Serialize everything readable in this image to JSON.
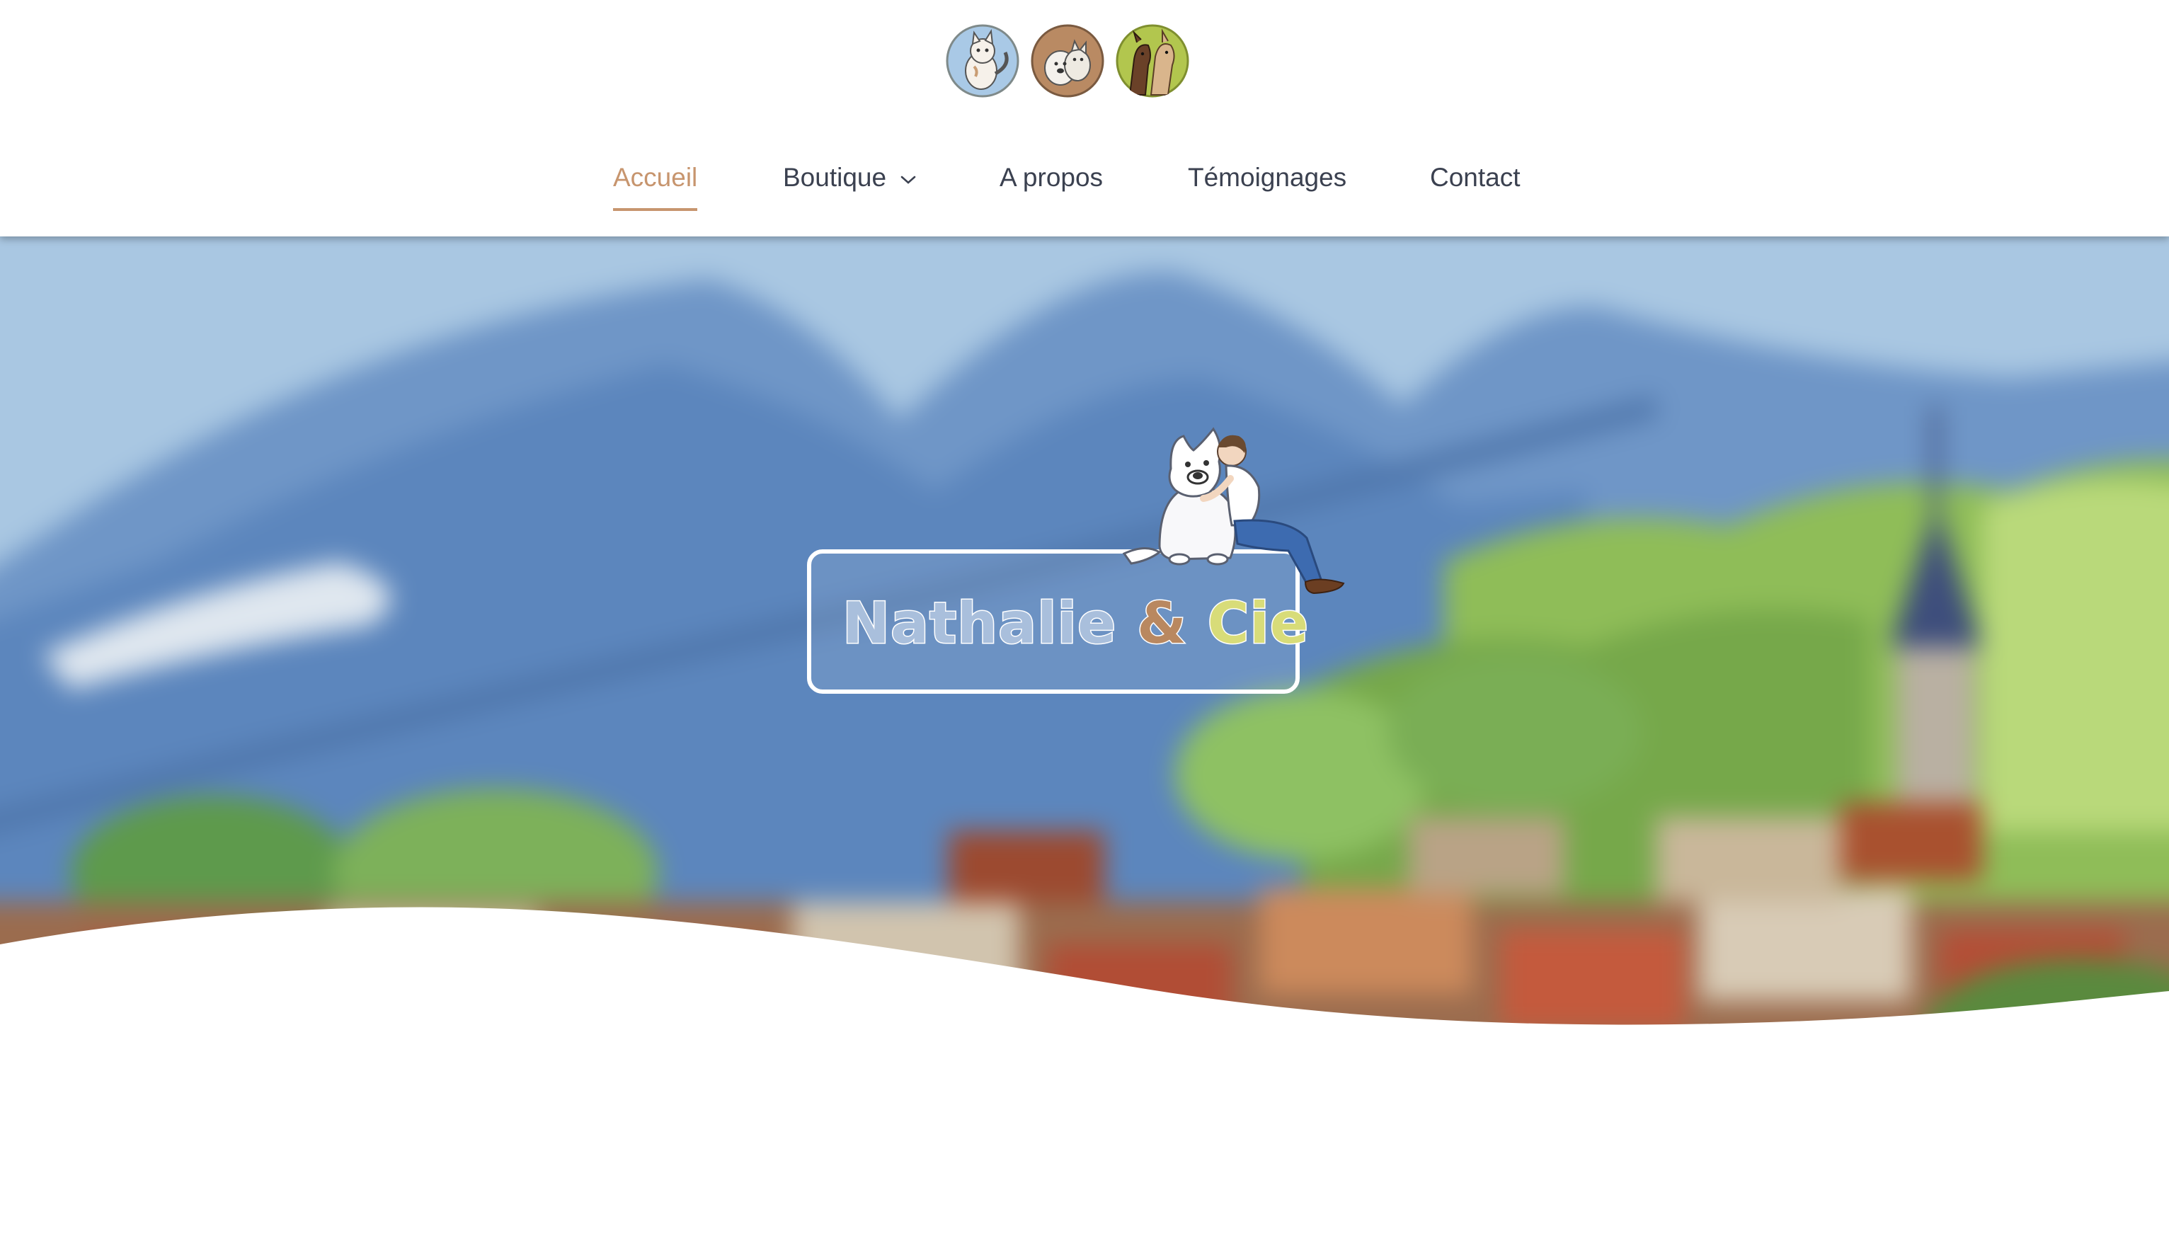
{
  "nav": {
    "items": [
      {
        "label": "Accueil",
        "active": true
      },
      {
        "label": "Boutique",
        "has_dropdown": true
      },
      {
        "label": "A propos"
      },
      {
        "label": "Témoignages"
      },
      {
        "label": "Contact"
      }
    ]
  },
  "logo": {
    "circles": [
      "cat-logo",
      "dogs-logo",
      "horses-logo"
    ]
  },
  "hero": {
    "brand_name_part1": "Nathalie",
    "brand_ampersand": "&",
    "brand_name_part2": "Cie"
  },
  "icons": {
    "dropdown": "chevron-down-icon"
  },
  "colors": {
    "accent": "#c7956e",
    "nav_text": "#3b4150",
    "brand_blue": "#a9bfdc",
    "brand_brown": "#b98860",
    "brand_yellow": "#d8dc79"
  }
}
